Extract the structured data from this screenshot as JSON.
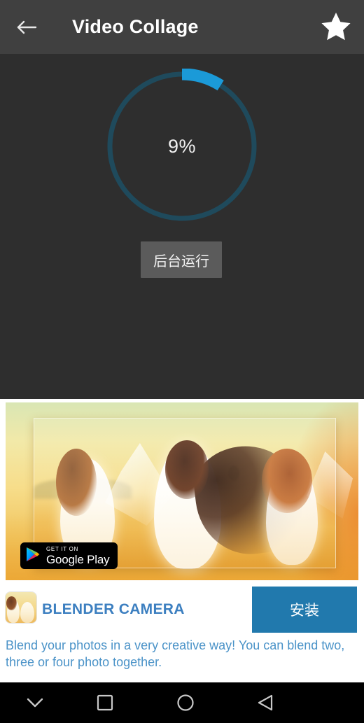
{
  "appbar": {
    "title": "Video Collage",
    "back_icon": "arrow-left-icon",
    "favorite_icon": "star-filled-icon"
  },
  "progress": {
    "percent_label": "9%",
    "percent_value": 9,
    "track_color": "#1f4a5c",
    "arc_color": "#1b9ad8",
    "background_button_label": "后台运行"
  },
  "ad": {
    "banner_alt": "three women in white dresses in a golden wheat field",
    "play_badge": {
      "small_label": "GET IT ON",
      "large_label": "Google Play",
      "icon": "google-play-triangle-icon"
    },
    "app_name": "BLENDER CAMERA",
    "app_name_color": "#3c7fc0",
    "install_label": "安装",
    "install_color": "#2179ad",
    "description": "Blend your photos in a very creative way! You can blend two, three or four photo together.",
    "description_color": "#4b93c8"
  },
  "navbar": {
    "buttons": [
      {
        "name": "hide-keyboard",
        "icon": "chevron-down-icon"
      },
      {
        "name": "recents",
        "icon": "square-icon"
      },
      {
        "name": "home",
        "icon": "circle-icon"
      },
      {
        "name": "back",
        "icon": "triangle-left-icon"
      }
    ]
  },
  "colors": {
    "appbar_bg": "#404040",
    "content_bg": "#2e2e2e",
    "card_bg": "#ffffff",
    "navbar_bg": "#000000"
  }
}
